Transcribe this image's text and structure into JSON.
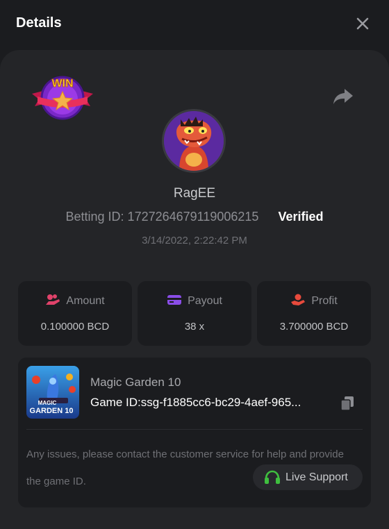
{
  "header": {
    "title": "Details"
  },
  "bet": {
    "username": "RagEE",
    "betting_id": "Betting ID: 1727264679119006215",
    "verified": "Verified",
    "datetime": "3/14/2022, 2:22:42 PM",
    "badge_text": "WIN"
  },
  "stats": [
    {
      "label": "Amount",
      "value": "0.100000 BCD",
      "icon": "coins-hand-icon",
      "color": "#e0426a"
    },
    {
      "label": "Payout",
      "value": "38 x",
      "icon": "card-icon",
      "color": "#8a4de8"
    },
    {
      "label": "Profit",
      "value": "3.700000 BCD",
      "icon": "hand-coin-icon",
      "color": "#e84a3c"
    }
  ],
  "game": {
    "name": "Magic Garden 10",
    "id": "Game ID:ssg-f1885cc6-bc29-4aef-965...",
    "thumb_text_1": "MAGIC",
    "thumb_text_2": "GARDEN 10",
    "notice": "Any issues, please contact the customer service for help and provide the game ID.",
    "support_label": "Live Support",
    "support_color": "#3fbf3f"
  }
}
